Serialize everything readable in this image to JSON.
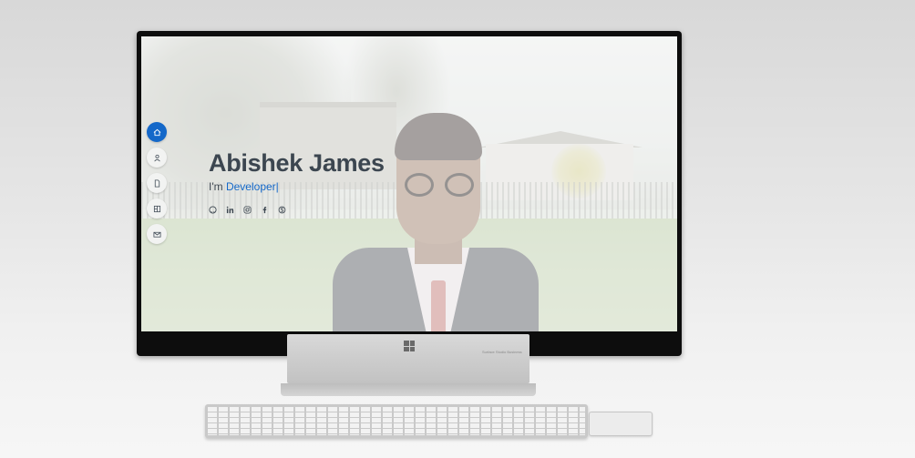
{
  "hero": {
    "name": "Abishek James",
    "role_prefix": "I'm ",
    "role_typed": "Developer",
    "caret": "|"
  },
  "nav": {
    "items": [
      {
        "id": "home",
        "icon": "home-icon",
        "active": true
      },
      {
        "id": "about",
        "icon": "user-icon",
        "active": false
      },
      {
        "id": "resume",
        "icon": "file-icon",
        "active": false
      },
      {
        "id": "portfolio",
        "icon": "book-icon",
        "active": false
      },
      {
        "id": "contact",
        "icon": "envelope-icon",
        "active": false
      }
    ]
  },
  "socials": [
    {
      "id": "github",
      "icon": "github-icon"
    },
    {
      "id": "linkedin",
      "icon": "linkedin-icon"
    },
    {
      "id": "instagram",
      "icon": "instagram-icon"
    },
    {
      "id": "facebook",
      "icon": "facebook-icon"
    },
    {
      "id": "skype",
      "icon": "skype-icon"
    }
  ],
  "colors": {
    "accent": "#1468c9",
    "heading": "#3c4650"
  },
  "stand": {
    "caption": "Surface Studio Business"
  }
}
